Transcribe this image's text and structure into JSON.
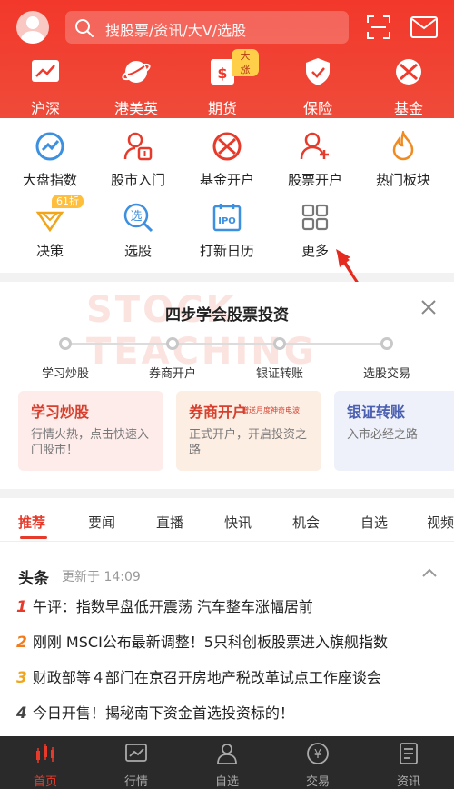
{
  "header": {
    "search_placeholder": "搜股票/资讯/大V/选股",
    "quick": [
      {
        "label": "沪深",
        "icon": "trend-chart-icon"
      },
      {
        "label": "港美英",
        "icon": "planet-icon"
      },
      {
        "label": "期货",
        "icon": "futures-icon",
        "badge": "大涨"
      },
      {
        "label": "保险",
        "icon": "shield-icon"
      },
      {
        "label": "基金",
        "icon": "fund-ball-icon"
      }
    ]
  },
  "menu": {
    "items": [
      {
        "label": "大盘指数",
        "icon": "index-chart-icon"
      },
      {
        "label": "股市入门",
        "icon": "stock-beginner-icon"
      },
      {
        "label": "基金开户",
        "icon": "fund-account-icon"
      },
      {
        "label": "股票开户",
        "icon": "add-user-icon"
      },
      {
        "label": "热门板块",
        "icon": "flame-icon"
      },
      {
        "label": "决策",
        "icon": "decision-icon",
        "badge": "61折"
      },
      {
        "label": "选股",
        "icon": "stock-picker-icon"
      },
      {
        "label": "打新日历",
        "icon": "ipo-calendar-icon"
      },
      {
        "label": "更多",
        "icon": "grid-more-icon"
      }
    ]
  },
  "guide": {
    "bg_text": "STOCK TEACHING",
    "title": "四步学会股票投资",
    "steps": [
      "学习炒股",
      "券商开户",
      "银证转账",
      "选股交易"
    ],
    "cards": [
      {
        "title": "学习炒股",
        "desc": "行情火热，点击快速入门股市！"
      },
      {
        "title": "券商开户",
        "desc": "正式开户，开启投资之路",
        "sub": "赠送月度神奇电波"
      },
      {
        "title": "银证转账",
        "desc": "入市必经之路"
      }
    ]
  },
  "news": {
    "tabs": [
      "推荐",
      "要闻",
      "直播",
      "快讯",
      "机会",
      "自选",
      "视频"
    ],
    "head_label": "头条",
    "updated": "更新于 14:09",
    "items": [
      {
        "num": "1",
        "text": "午评：指数早盘低开震荡 汽车整车涨幅居前"
      },
      {
        "num": "2",
        "text": "刚刚 MSCI公布最新调整！5只科创板股票进入旗舰指数"
      },
      {
        "num": "3",
        "text": "财政部等４部门在京召开房地产税改革试点工作座谈会"
      },
      {
        "num": "4",
        "text": "今日开售！揭秘南下资金首选投资标的！"
      }
    ]
  },
  "bottom_nav": [
    {
      "label": "首页",
      "icon": "home-candle-icon",
      "active": true
    },
    {
      "label": "行情",
      "icon": "market-icon"
    },
    {
      "label": "自选",
      "icon": "watchlist-icon"
    },
    {
      "label": "交易",
      "icon": "trade-yen-icon"
    },
    {
      "label": "资讯",
      "icon": "news-doc-icon"
    }
  ],
  "colors": {
    "brand_red": "#ef3b2d",
    "num1": "#e73a2b",
    "num2": "#f07c1b",
    "num3": "#f0a51b",
    "num4": "#444444"
  }
}
